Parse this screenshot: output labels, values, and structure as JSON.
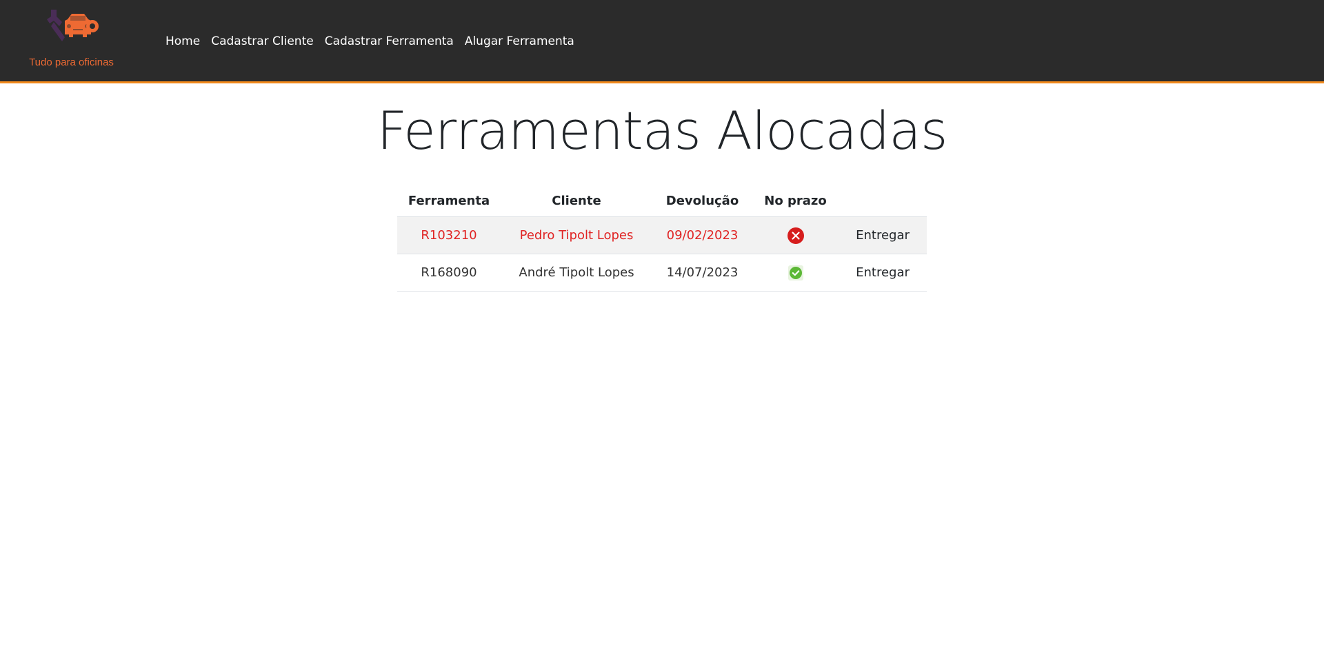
{
  "brand": {
    "tagline": "Tudo para oficinas",
    "logo_icon": "wrench-car-icon",
    "colors": {
      "logo_orange": "#ee6a33",
      "logo_purple": "#4a2d57"
    }
  },
  "nav": {
    "items": [
      {
        "label": "Home"
      },
      {
        "label": "Cadastrar Cliente"
      },
      {
        "label": "Cadastrar Ferramenta"
      },
      {
        "label": "Alugar Ferramenta"
      }
    ]
  },
  "page": {
    "title": "Ferramentas Alocadas"
  },
  "table": {
    "headers": {
      "tool": "Ferramenta",
      "client": "Cliente",
      "return_date": "Devolução",
      "on_time": "No prazo",
      "action": ""
    },
    "rows": [
      {
        "tool": "R103210",
        "client": "Pedro Tipolt Lopes",
        "return_date": "09/02/2023",
        "on_time": false,
        "status_icon": "x-circle-icon",
        "action": "Entregar"
      },
      {
        "tool": "R168090",
        "client": "André Tipolt Lopes",
        "return_date": "14/07/2023",
        "on_time": true,
        "status_icon": "check-circle-icon",
        "action": "Entregar"
      }
    ]
  },
  "colors": {
    "navbar_bg": "#2b2b2b",
    "navbar_border": "#f28a1c",
    "late_text": "#e02424",
    "late_row_bg": "#f2f2f2",
    "status_late": "#d61d1d",
    "status_ok": "#5cb836"
  }
}
